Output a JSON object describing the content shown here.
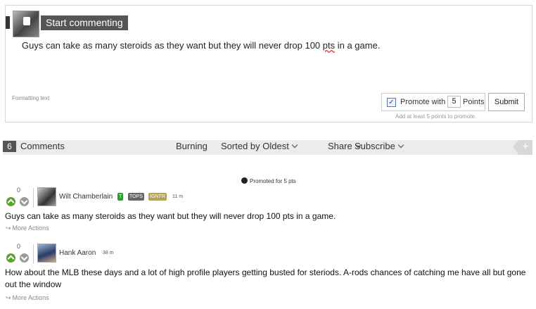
{
  "composer": {
    "start_label": "Start commenting",
    "draft_text_before": "Guys can take as many steroids as they want but they will never drop 100 ",
    "draft_text_misspelled": "pts",
    "draft_text_after": " in a game.",
    "formatting_link": "Formatting text",
    "promote_label": "Promote with",
    "promote_points": "5",
    "points_label": "Points",
    "promote_checked": true,
    "submit_label": "Submit",
    "promote_hint": "Add at least 5 points to promote."
  },
  "comments_bar": {
    "count": "6",
    "label": "Comments",
    "burning": "Burning",
    "sort": "Sorted by Oldest",
    "share": "Share",
    "subscribe": "Subscribe",
    "plus": "+"
  },
  "promoted_note": "Promoted for 5 pts",
  "comments": [
    {
      "votes": "0",
      "author": "Wilt Chamberlain",
      "badges": [
        "T",
        "TOPS",
        "IGNTR"
      ],
      "time": "11 m",
      "body": "Guys can take as many steroids as they want but they will never drop 100 pts in a game.",
      "more_actions": "More Actions"
    },
    {
      "votes": "0",
      "author": "Hank Aaron",
      "time": "38 m",
      "body": "How about the MLB these days and a lot of high profile players getting busted for steriods. A-rods chances of catching me have all but gone out the window",
      "more_actions": "More Actions"
    }
  ],
  "colors": {
    "upvote": "#56a33a",
    "downvote": "#9a9a9a",
    "badge_t": "#2d9b2d",
    "badge_tops": "#666666",
    "badge_ignitr": "#b3a25a"
  }
}
